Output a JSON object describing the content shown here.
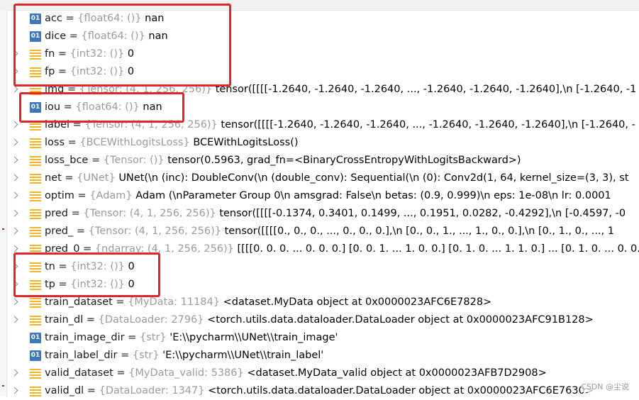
{
  "variables": [
    {
      "icon": "num",
      "expandable": false,
      "name": "acc",
      "type": "{float64: ()}",
      "value": "nan"
    },
    {
      "icon": "num",
      "expandable": false,
      "name": "dice",
      "type": "{float64: ()}",
      "value": "nan"
    },
    {
      "icon": "obj",
      "expandable": true,
      "name": "fn",
      "type": "{int32: ()}",
      "value": "0"
    },
    {
      "icon": "obj",
      "expandable": true,
      "name": "fp",
      "type": "{int32: ()}",
      "value": "0"
    },
    {
      "icon": "obj",
      "expandable": true,
      "name": "img",
      "type": "{Tensor: (4, 1, 256, 256)}",
      "value": "tensor([[[[-1.2640, -1.2640, -1.2640,  ..., -1.2640, -1.2640, -1.2640],\\n          [-1.2640, -1"
    },
    {
      "icon": "num",
      "expandable": false,
      "name": "iou",
      "type": "{float64: ()}",
      "value": "nan"
    },
    {
      "icon": "obj",
      "expandable": true,
      "name": "label",
      "type": "{Tensor: (4, 1, 256, 256)}",
      "value": "tensor([[[[-1.2640, -1.2640, -1.2640,  ..., -1.2640, -1.2640, -1.2640],\\n          [-1.2640, -"
    },
    {
      "icon": "obj",
      "expandable": true,
      "name": "loss",
      "type": "{BCEWithLogitsLoss}",
      "value": "BCEWithLogitsLoss()"
    },
    {
      "icon": "obj",
      "expandable": true,
      "name": "loss_bce",
      "type": "{Tensor: ()}",
      "value": "tensor(0.5963, grad_fn=<BinaryCrossEntropyWithLogitsBackward>)"
    },
    {
      "icon": "obj",
      "expandable": true,
      "name": "net",
      "type": "{UNet}",
      "value": "UNet(\\n  (inc): DoubleConv(\\n    (double_conv): Sequential(\\n      (0): Conv2d(1, 64, kernel_size=(3, 3), st"
    },
    {
      "icon": "obj",
      "expandable": true,
      "name": "optim",
      "type": "{Adam}",
      "value": "Adam (\\nParameter Group 0\\n    amsgrad: False\\n    betas: (0.9, 0.999)\\n    eps: 1e-08\\n    lr: 0.0001"
    },
    {
      "icon": "obj",
      "expandable": true,
      "name": "pred",
      "type": "{Tensor: (4, 1, 256, 256)}",
      "value": "tensor([[[[-0.1374,  0.3401,  0.1499,  ...,  0.1951,  0.0282, -0.4292],\\n          [-0.4597, -0"
    },
    {
      "icon": "obj",
      "expandable": true,
      "name": "pred_",
      "type": "{Tensor: (4, 1, 256, 256)}",
      "value": "tensor([[[[0., 0., 0.,  ..., 0., 0., 0.],\\n          [0., 0., 1.,  ..., 1., 0., 0.],\\n          [0., 1., 0.,  ..., 1"
    },
    {
      "icon": "obj",
      "expandable": true,
      "name": "pred_0",
      "type": "{ndarray: (4, 1, 256, 256)}",
      "value": "[[[[0. 0. 0. ... 0. 0. 0.]    [0. 0. 1. ... 1. 0. 0.]    [0. 1. 0. ... 1. 1. 0.]    ...    [0. 1. 0. ... 0. 0. 0."
    },
    {
      "icon": "obj",
      "expandable": true,
      "name": "tn",
      "type": "{int32: ()}",
      "value": "0"
    },
    {
      "icon": "obj",
      "expandable": true,
      "name": "tp",
      "type": "{int32: ()}",
      "value": "0"
    },
    {
      "icon": "obj",
      "expandable": true,
      "name": "train_dataset",
      "type": "{MyData: 11184}",
      "value": "<dataset.MyData object at 0x0000023AFC6E7828>"
    },
    {
      "icon": "obj",
      "expandable": true,
      "name": "train_dl",
      "type": "{DataLoader: 2796}",
      "value": "<torch.utils.data.dataloader.DataLoader object at 0x0000023AFC91B128>"
    },
    {
      "icon": "num",
      "expandable": false,
      "name": "train_image_dir",
      "type": "{str}",
      "value": "'E:\\\\pycharm\\\\UNet\\\\train_image'"
    },
    {
      "icon": "num",
      "expandable": false,
      "name": "train_label_dir",
      "type": "{str}",
      "value": "'E:\\\\pycharm\\\\UNet\\\\train_label'"
    },
    {
      "icon": "obj",
      "expandable": true,
      "name": "valid_dataset",
      "type": "{MyData_valid: 5386}",
      "value": "<dataset.MyData_valid object at 0x0000023AFB7D2908>"
    },
    {
      "icon": "obj",
      "expandable": true,
      "name": "valid_dl",
      "type": "{DataLoader: 1347}",
      "value": "<torch.utils.data.dataloader.DataLoader object at 0x0000023AFC6E7630>"
    }
  ],
  "icon_labels": {
    "num": "01"
  },
  "watermark": "CSDN @尘说",
  "colors": {
    "highlight": "#e0262b",
    "type_text": "#9b9b9b",
    "num_icon": "#3f78b8",
    "obj_icon": "#f0b429"
  }
}
